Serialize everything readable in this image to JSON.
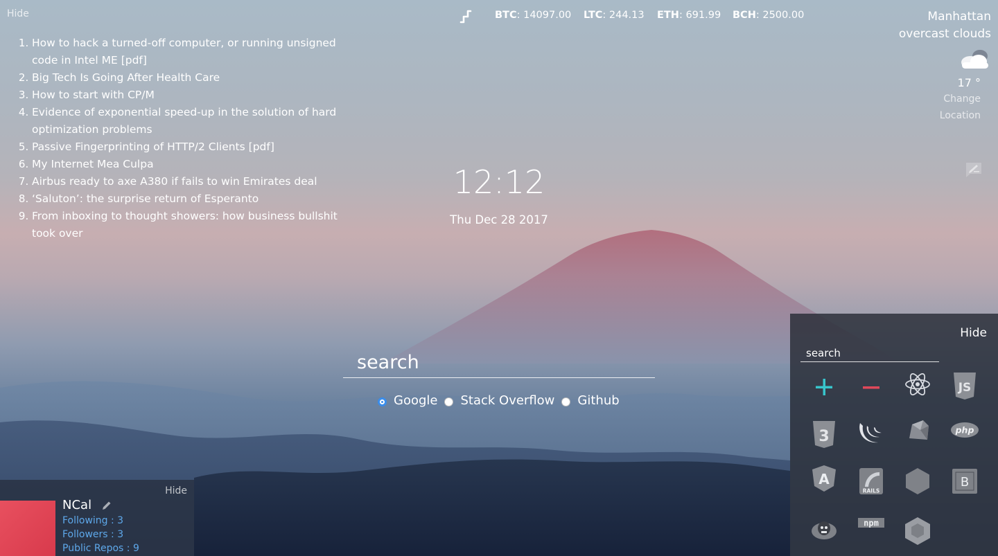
{
  "news": {
    "hide_label": "Hide",
    "items": [
      "How to hack a turned-off computer, or running unsigned code in Intel ME [pdf]",
      "Big Tech Is Going After Health Care",
      "How to start with CP/M",
      "Evidence of exponential speed-up in the solution of hard optimization problems",
      "Passive Fingerprinting of HTTP/2 Clients [pdf]",
      "My Internet Mea Culpa",
      "Airbus ready to axe A380 if fails to win Emirates deal",
      "‘Saluton’: the surprise return of Esperanto",
      "From inboxing to thought showers: how business bullshit took over"
    ]
  },
  "crypto": {
    "icon": "chart-line-icon",
    "tickers": [
      {
        "symbol": "BTC",
        "value": "14097.00"
      },
      {
        "symbol": "LTC",
        "value": "244.13"
      },
      {
        "symbol": "ETH",
        "value": "691.99"
      },
      {
        "symbol": "BCH",
        "value": "2500.00"
      }
    ]
  },
  "weather": {
    "city": "Manhattan",
    "description": "overcast clouds",
    "icon": "cloud-icon",
    "temperature": "17 °",
    "change_location": "Change Location"
  },
  "clock": {
    "time": "12:12",
    "date": "Thu Dec 28 2017"
  },
  "search": {
    "placeholder": "search",
    "engines": [
      {
        "label": "Google",
        "selected": true
      },
      {
        "label": "Stack Overflow",
        "selected": false
      },
      {
        "label": "Github",
        "selected": false
      }
    ]
  },
  "github": {
    "hide_label": "Hide",
    "name": "NCal",
    "following": "Following : 3",
    "followers": "Followers : 3",
    "repos": "Public Repos : 9"
  },
  "bookmarks": {
    "hide_label": "Hide",
    "search_placeholder": "search",
    "tiles": [
      "add-icon",
      "remove-icon",
      "react-icon",
      "javascript-icon",
      "css3-icon",
      "jquery-icon",
      "ruby-icon",
      "php-icon",
      "angular-icon",
      "rails-icon",
      "nodejs-icon",
      "bootstrap-icon",
      "grunt-icon",
      "npm-icon",
      "package-icon"
    ],
    "tile_text": {
      "php": "php",
      "npm": "npm",
      "bootstrap": "B",
      "angular": "A",
      "js": "JS",
      "css": "3",
      "rails": "RAILS"
    },
    "accent_add": "#38c5cc",
    "accent_remove": "#e0485a"
  }
}
